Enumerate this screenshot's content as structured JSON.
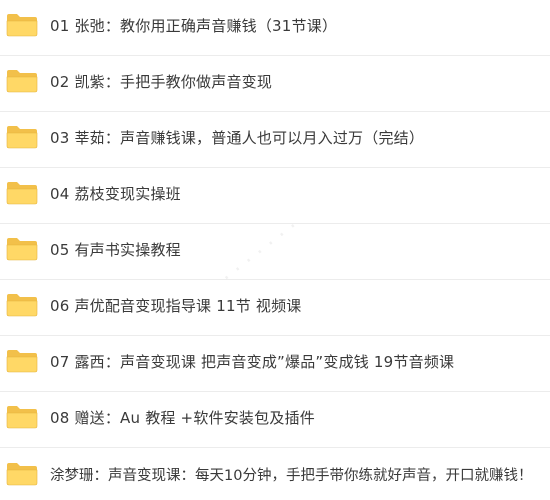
{
  "folders": [
    {
      "label": "01 张弛：教你用正确声音赚钱（31节课）",
      "icon": "folder-icon"
    },
    {
      "label": "02 凯紫：手把手教你做声音变现",
      "icon": "folder-icon"
    },
    {
      "label": "03 莘茹：声音赚钱课，普通人也可以月入过万（完结）",
      "icon": "folder-icon"
    },
    {
      "label": "04 荔枝变现实操班",
      "icon": "folder-icon"
    },
    {
      "label": "05 有声书实操教程",
      "icon": "folder-icon"
    },
    {
      "label": "06 声优配音变现指导课 11节 视频课",
      "icon": "folder-icon"
    },
    {
      "label": "07 露西：声音变现课 把声音变成”爆品”变成钱 19节音频课",
      "icon": "folder-icon"
    },
    {
      "label": "08 赠送：Au 教程 +软件安装包及插件",
      "icon": "folder-icon"
    },
    {
      "label": "涂梦珊：声音变现课：每天10分钟，手把手带你练就好声音，开口就赚钱！",
      "icon": "folder-icon"
    }
  ],
  "colors": {
    "folder_back": "#f2c04a",
    "folder_front": "#ffd866",
    "folder_edge": "#e6b43c",
    "text": "#3a3a3a"
  }
}
